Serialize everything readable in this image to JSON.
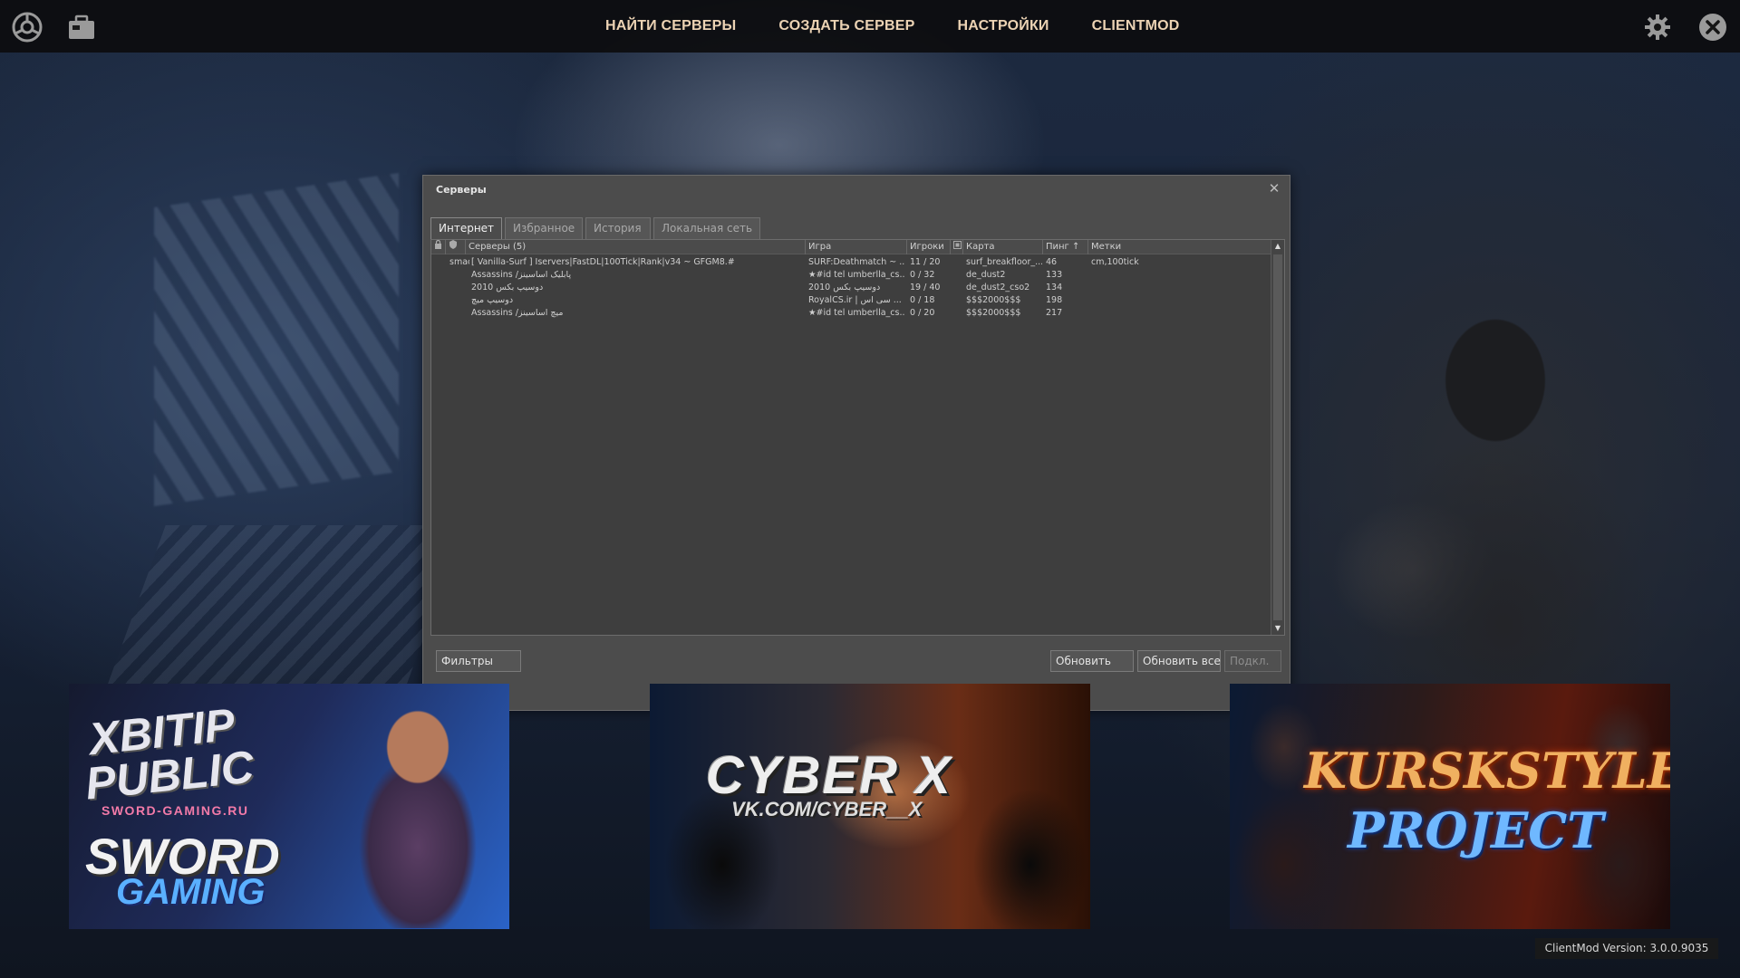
{
  "topbar": {
    "left_icons": [
      "steam-logo-icon",
      "briefcase-icon"
    ],
    "nav": [
      "НАЙТИ СЕРВЕРЫ",
      "СОЗДАТЬ СЕРВЕР",
      "НАСТРОЙКИ",
      "CLIENTMOD"
    ],
    "right_icons": [
      "gear-icon",
      "close-icon"
    ]
  },
  "dialog": {
    "title": "Серверы",
    "close": "✕",
    "tabs": [
      "Интернет",
      "Избранное",
      "История",
      "Локальная сеть"
    ],
    "active_tab": "Интернет",
    "columns": {
      "servers": "Серверы (5)",
      "game": "Игра",
      "players": "Игроки",
      "map": "Карта",
      "ping": "Пинг ↑",
      "tags": "Метки"
    },
    "rows": [
      {
        "prefix": "smac",
        "name": "[ Vanilla-Surf ] Iservers|FastDL|100Tick|Rank|v34 ~ GFGM8.#",
        "game": "SURF:Deathmatch ~ ...",
        "players": "11 / 20",
        "map": "surf_breakfloor_...",
        "ping": "46",
        "tags": "cm,100tick"
      },
      {
        "prefix": "",
        "name": "Assassins /پابلیک اساسینز",
        "game": "★#id tel  umberlla_cs...",
        "players": "0 / 32",
        "map": "de_dust2",
        "ping": "133",
        "tags": ""
      },
      {
        "prefix": "",
        "name": "دوسیپ بکس 2010",
        "game": "2010 دوسیپ بکس",
        "players": "19 / 40",
        "map": "de_dust2_cso2",
        "ping": "134",
        "tags": ""
      },
      {
        "prefix": "",
        "name": "دوسیپ میچ",
        "game": "RoyalCS.ir | سی اس ...",
        "players": "0 / 18",
        "map": "$$$2000$$$",
        "ping": "198",
        "tags": ""
      },
      {
        "prefix": "",
        "name": "Assassins /میچ اساسینز",
        "game": "★#id tel  umberlla_cs...",
        "players": "0 / 20",
        "map": "$$$2000$$$",
        "ping": "217",
        "tags": ""
      }
    ],
    "buttons": {
      "filters": "Фильтры",
      "refresh": "Обновить",
      "refresh_all": "Обновить все",
      "connect": "Подкл."
    }
  },
  "banners": [
    {
      "lines": [
        "XBITIP",
        "PUBLIC",
        "SWORD-GAMING.RU",
        "SWORD",
        "GAMING"
      ]
    },
    {
      "lines": [
        "CYBER X",
        "VK.COM/CYBER__X"
      ]
    },
    {
      "lines": [
        "KURSKSTYLE",
        "PROJECT"
      ]
    }
  ],
  "version": "ClientMod Version: 3.0.0.9035",
  "colors": {
    "nav_text": "#ecd3b4",
    "dialog_bg": "#4c4c4c",
    "list_bg": "#3e3e3e"
  }
}
